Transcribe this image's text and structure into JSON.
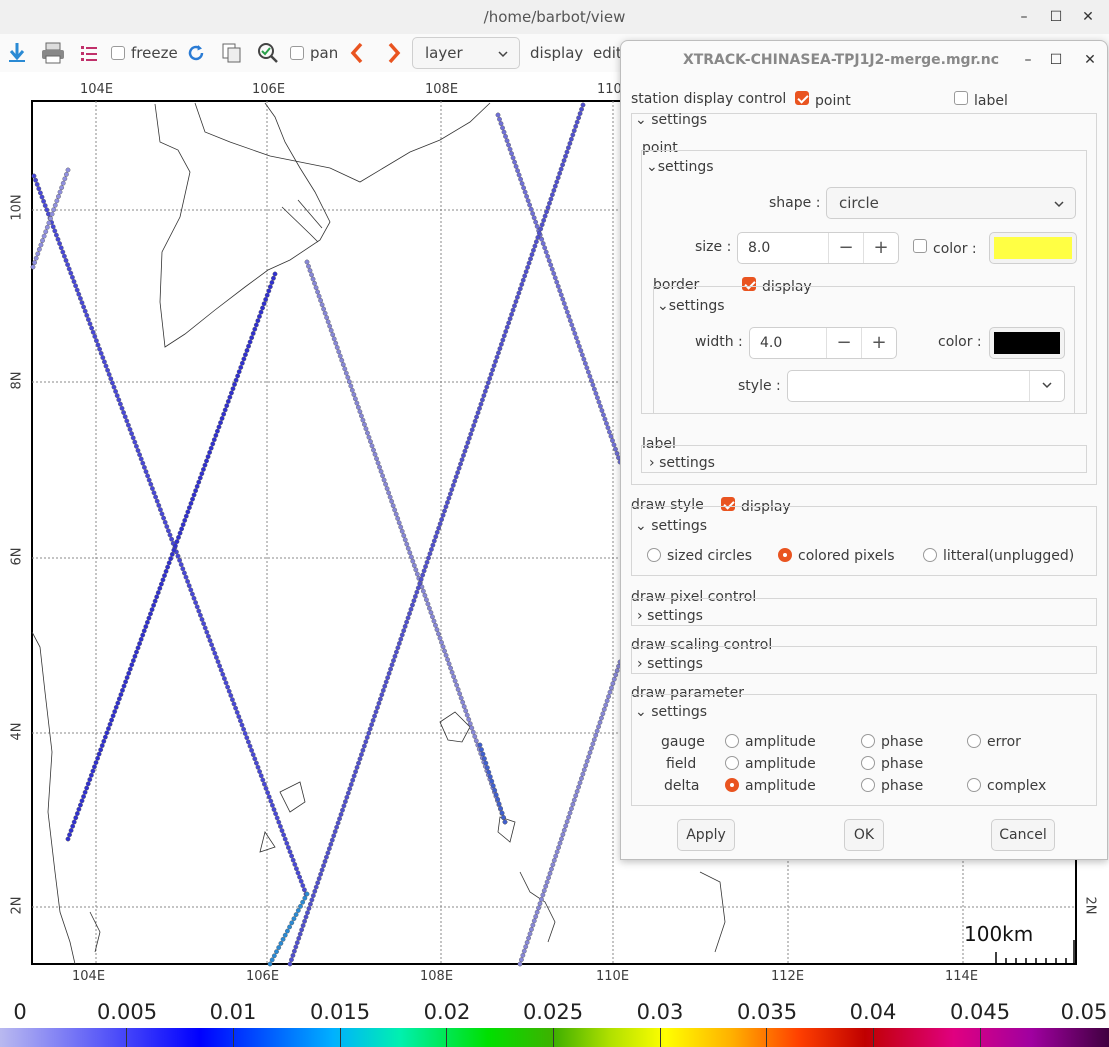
{
  "window": {
    "title": "/home/barbot/view",
    "minimize": "–",
    "maximize": "☐",
    "close": "✕"
  },
  "toolbar": {
    "freeze_label": "freeze",
    "pan_label": "pan",
    "layer_combo": "layer",
    "display_menu": "display",
    "edit_menu": "edit"
  },
  "map": {
    "x_ticks": [
      "104E",
      "106E",
      "108E",
      "110E",
      "112E",
      "114E"
    ],
    "top_ticks": [
      "104E",
      "106E",
      "108E",
      "110"
    ],
    "y_ticks": [
      "10N",
      "8N",
      "6N",
      "4N",
      "2N"
    ],
    "right_tick": "2N",
    "scale_label": "100km"
  },
  "colorbar": {
    "ticks": [
      "0",
      "0.005",
      "0.01",
      "0.015",
      "0.02",
      "0.025",
      "0.03",
      "0.035",
      "0.04",
      "0.045",
      "0.05"
    ]
  },
  "dialog": {
    "title": "XTRACK-CHINASEA-TPJ1J2-merge.mgr.nc",
    "station_display_control": "station display control",
    "point_check": "point",
    "label_check": "label",
    "settings": "settings",
    "point_group": "point",
    "shape_label": "shape :",
    "shape_value": "circle",
    "size_label": "size :",
    "size_value": "8.0",
    "color_label": "color :",
    "point_color": "#ffff44",
    "border_group": "border",
    "display_check": "display",
    "width_label": "width :",
    "width_value": "4.0",
    "border_color": "#000000",
    "style_label": "style :",
    "label_group": "label",
    "draw_style": "draw style",
    "sized_circles": "sized circles",
    "colored_pixels": "colored pixels",
    "litteral": "litteral(unplugged)",
    "draw_pixel_control": "draw pixel control",
    "draw_scaling_control": "draw scaling control",
    "draw_parameter": "draw parameter",
    "rows": [
      "gauge",
      "field",
      "delta"
    ],
    "amplitude": "amplitude",
    "phase": "phase",
    "error": "error",
    "complex": "complex",
    "apply": "Apply",
    "ok": "OK",
    "cancel": "Cancel"
  },
  "colors": {
    "accent": "#e95420"
  }
}
